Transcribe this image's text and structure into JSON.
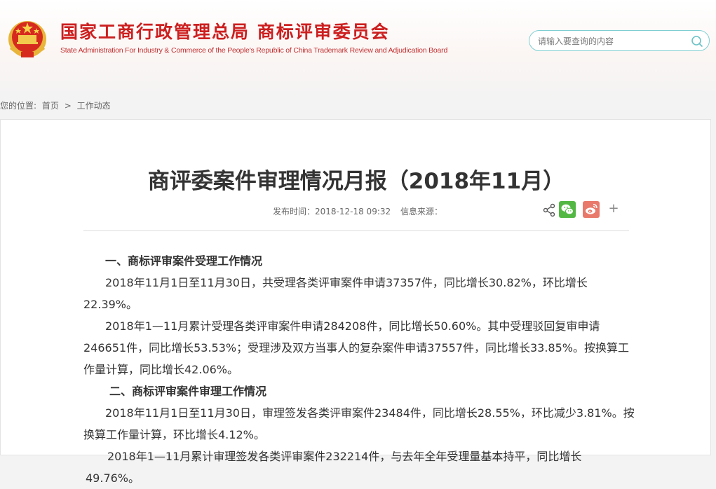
{
  "header": {
    "title_cn": "国家工商行政管理总局  商标评审委员会",
    "title_en": "State Administration For Industry & Commerce of the People's Republic of China Trademark Review and Adjudication Board",
    "search_placeholder": "请输入要查询的内容"
  },
  "breadcrumb": {
    "label": "您的位置:",
    "home": "首页",
    "sep": ">",
    "current": "工作动态"
  },
  "article": {
    "title": "商评委案件审理情况月报（2018年11月）",
    "publish_time": "发布时间：2018-12-18 09:32",
    "source": "信息来源：",
    "share_plus": "+",
    "sections": [
      {
        "heading": "一、商标评审案件受理工作情况",
        "paragraphs": [
          "2018年11月1日至11月30日，共受理各类评审案件申请37357件，同比增长30.82%，环比增长22.39%。",
          "2018年1—11月累计受理各类评审案件申请284208件，同比增长50.60%。其中受理驳回复审申请246651件，同比增长53.53%；受理涉及双方当事人的复杂案件申请37557件，同比增长33.85%。按换算工作量计算，同比增长42.06%。"
        ]
      },
      {
        "heading": "二、商标评审案件审理工作情况",
        "paragraphs": [
          "2018年11月1日至11月30日，审理签发各类评审案件23484件，同比增长28.55%，环比减少3.81%。按换算工作量计算，环比增长4.12%。",
          "2018年1—11月累计审理签发各类评审案件232214件，与去年全年受理量基本持平，同比增长49.76%。"
        ]
      }
    ]
  },
  "colors": {
    "brand_red": "#cc1f1f",
    "search_border": "#7fcfd2",
    "wechat_green": "#53b843",
    "weibo_red": "#e8796b"
  },
  "icons": [
    "emblem-icon",
    "search-icon",
    "share-icon",
    "wechat-icon",
    "weibo-icon",
    "plus-icon"
  ]
}
